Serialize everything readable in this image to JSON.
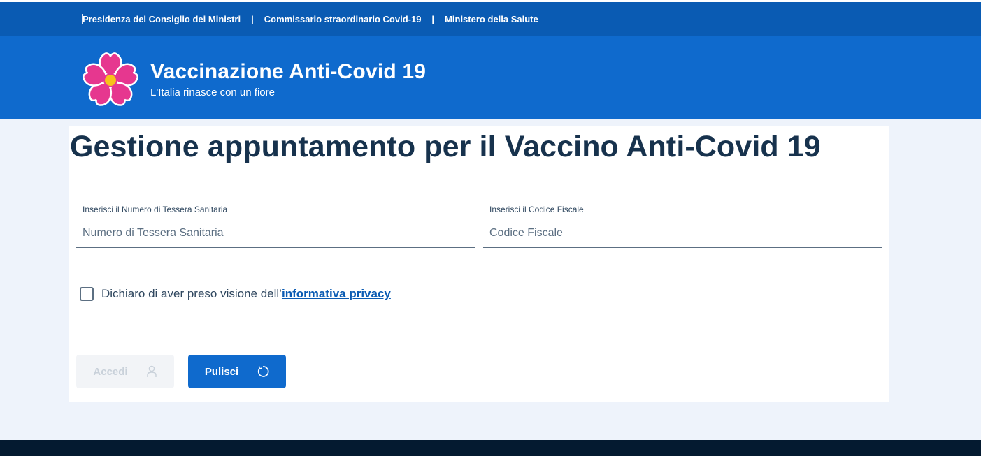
{
  "topbar": {
    "links": [
      "Presidenza del Consiglio dei Ministri",
      "Commissario straordinario Covid-19",
      "Ministero della Salute"
    ],
    "separator": "|"
  },
  "header": {
    "logo_icon": "primrose-flower-icon",
    "title": "Vaccinazione Anti-Covid 19",
    "subtitle": "L'Italia rinasce con un fiore"
  },
  "main": {
    "title": "Gestione appuntamento per il Vaccino Anti-Covid 19",
    "fields": [
      {
        "label": "Inserisci il Numero di Tessera Sanitaria",
        "placeholder": "Numero di Tessera Sanitaria",
        "value": ""
      },
      {
        "label": "Inserisci il Codice Fiscale",
        "placeholder": "Codice Fiscale",
        "value": ""
      }
    ],
    "consent": {
      "checked": false,
      "text": "Dichiaro di aver preso visione dell’",
      "link": "informativa privacy"
    },
    "buttons": {
      "accedi": {
        "label": "Accedi",
        "icon": "user-icon",
        "disabled": true
      },
      "pulisci": {
        "label": "Pulisci",
        "icon": "refresh-icon"
      }
    }
  },
  "colors": {
    "topbar": "#0a5bb3",
    "header": "#0f6acd",
    "title_text": "#17324d",
    "link": "#0a5bb3",
    "footer": "#041a30",
    "flower_petals": "#e6378f",
    "flower_center": "#f7c21a"
  }
}
